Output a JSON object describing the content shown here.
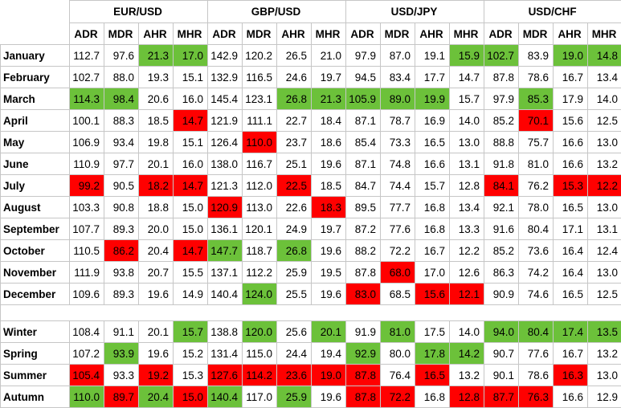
{
  "colors": {
    "high": "#6cc13a",
    "low": "#ff0000",
    "grid": "#c6c6c6"
  },
  "pairs": [
    "EUR/USD",
    "GBP/USD",
    "USD/JPY",
    "USD/CHF"
  ],
  "metrics": [
    "ADR",
    "MDR",
    "AHR",
    "MHR"
  ],
  "months": [
    {
      "label": "January",
      "values": [
        "112.7",
        "97.6",
        "21.3",
        "17.0",
        "142.9",
        "120.2",
        "26.5",
        "21.0",
        "97.9",
        "87.0",
        "19.1",
        "15.9",
        "102.7",
        "83.9",
        "19.0",
        "14.8"
      ],
      "hl": [
        "",
        "",
        "g",
        "g",
        "",
        "",
        "",
        "",
        "",
        "",
        "",
        "g",
        "g",
        "",
        "g",
        "g"
      ]
    },
    {
      "label": "February",
      "values": [
        "102.7",
        "88.0",
        "19.3",
        "15.1",
        "132.9",
        "116.5",
        "24.6",
        "19.7",
        "94.5",
        "83.4",
        "17.7",
        "14.7",
        "87.8",
        "78.6",
        "16.7",
        "13.4"
      ],
      "hl": [
        "",
        "",
        "",
        "",
        "",
        "",
        "",
        "",
        "",
        "",
        "",
        "",
        "",
        "",
        "",
        ""
      ]
    },
    {
      "label": "March",
      "values": [
        "114.3",
        "98.4",
        "20.6",
        "16.0",
        "145.4",
        "123.1",
        "26.8",
        "21.3",
        "105.9",
        "89.0",
        "19.9",
        "15.7",
        "97.9",
        "85.3",
        "17.9",
        "14.0"
      ],
      "hl": [
        "g",
        "g",
        "",
        "",
        "",
        "",
        "g",
        "g",
        "g",
        "g",
        "g",
        "",
        "",
        "g",
        "",
        ""
      ]
    },
    {
      "label": "April",
      "values": [
        "100.1",
        "88.3",
        "18.5",
        "14.7",
        "121.9",
        "111.1",
        "22.7",
        "18.4",
        "87.1",
        "78.7",
        "16.9",
        "14.0",
        "85.2",
        "70.1",
        "15.6",
        "12.5"
      ],
      "hl": [
        "",
        "",
        "",
        "r",
        "",
        "",
        "",
        "",
        "",
        "",
        "",
        "",
        "",
        "r",
        "",
        ""
      ]
    },
    {
      "label": "May",
      "values": [
        "106.9",
        "93.4",
        "19.8",
        "15.1",
        "126.4",
        "110.0",
        "23.7",
        "18.6",
        "85.4",
        "73.3",
        "16.5",
        "13.0",
        "88.8",
        "75.7",
        "16.6",
        "13.0"
      ],
      "hl": [
        "",
        "",
        "",
        "",
        "",
        "r",
        "",
        "",
        "",
        "",
        "",
        "",
        "",
        "",
        "",
        ""
      ]
    },
    {
      "label": "June",
      "values": [
        "110.9",
        "97.7",
        "20.1",
        "16.0",
        "138.0",
        "116.7",
        "25.1",
        "19.6",
        "87.1",
        "74.8",
        "16.6",
        "13.1",
        "91.8",
        "81.0",
        "16.6",
        "13.2"
      ],
      "hl": [
        "",
        "",
        "",
        "",
        "",
        "",
        "",
        "",
        "",
        "",
        "",
        "",
        "",
        "",
        "",
        ""
      ]
    },
    {
      "label": "July",
      "values": [
        "99.2",
        "90.5",
        "18.2",
        "14.7",
        "121.3",
        "112.0",
        "22.5",
        "18.5",
        "84.7",
        "74.4",
        "15.7",
        "12.8",
        "84.1",
        "76.2",
        "15.3",
        "12.2"
      ],
      "hl": [
        "r",
        "",
        "r",
        "r",
        "",
        "",
        "r",
        "",
        "",
        "",
        "",
        "",
        "r",
        "",
        "r",
        "r"
      ]
    },
    {
      "label": "August",
      "values": [
        "103.3",
        "90.8",
        "18.8",
        "15.0",
        "120.9",
        "113.0",
        "22.6",
        "18.3",
        "89.5",
        "77.7",
        "16.8",
        "13.4",
        "92.1",
        "78.0",
        "16.5",
        "13.0"
      ],
      "hl": [
        "",
        "",
        "",
        "",
        "r",
        "",
        "",
        "r",
        "",
        "",
        "",
        "",
        "",
        "",
        "",
        ""
      ]
    },
    {
      "label": "September",
      "values": [
        "107.7",
        "89.3",
        "20.0",
        "15.0",
        "136.1",
        "120.1",
        "24.9",
        "19.7",
        "87.2",
        "77.6",
        "16.8",
        "13.3",
        "91.6",
        "80.4",
        "17.1",
        "13.1"
      ],
      "hl": [
        "",
        "",
        "",
        "",
        "",
        "",
        "",
        "",
        "",
        "",
        "",
        "",
        "",
        "",
        "",
        ""
      ]
    },
    {
      "label": "October",
      "values": [
        "110.5",
        "86.2",
        "20.4",
        "14.7",
        "147.7",
        "118.7",
        "26.8",
        "19.6",
        "88.2",
        "72.2",
        "16.7",
        "12.2",
        "85.2",
        "73.6",
        "16.4",
        "12.4"
      ],
      "hl": [
        "",
        "r",
        "",
        "r",
        "g",
        "",
        "g",
        "",
        "",
        "",
        "",
        "",
        "",
        "",
        "",
        ""
      ]
    },
    {
      "label": "November",
      "values": [
        "111.9",
        "93.8",
        "20.7",
        "15.5",
        "137.1",
        "112.2",
        "25.9",
        "19.5",
        "87.8",
        "68.0",
        "17.0",
        "12.6",
        "86.3",
        "74.2",
        "16.4",
        "13.0"
      ],
      "hl": [
        "",
        "",
        "",
        "",
        "",
        "",
        "",
        "",
        "",
        "r",
        "",
        "",
        "",
        "",
        "",
        ""
      ]
    },
    {
      "label": "December",
      "values": [
        "109.6",
        "89.3",
        "19.6",
        "14.9",
        "140.4",
        "124.0",
        "25.5",
        "19.6",
        "83.0",
        "68.5",
        "15.6",
        "12.1",
        "90.9",
        "74.6",
        "16.5",
        "12.5"
      ],
      "hl": [
        "",
        "",
        "",
        "",
        "",
        "g",
        "",
        "",
        "r",
        "",
        "r",
        "r",
        "",
        "",
        "",
        ""
      ]
    }
  ],
  "seasons": [
    {
      "label": "Winter",
      "values": [
        "108.4",
        "91.1",
        "20.1",
        "15.7",
        "138.8",
        "120.0",
        "25.6",
        "20.1",
        "91.9",
        "81.0",
        "17.5",
        "14.0",
        "94.0",
        "80.4",
        "17.4",
        "13.5"
      ],
      "hl": [
        "",
        "",
        "",
        "g",
        "",
        "g",
        "",
        "g",
        "",
        "g",
        "",
        "",
        "g",
        "g",
        "g",
        "g"
      ]
    },
    {
      "label": "Spring",
      "values": [
        "107.2",
        "93.9",
        "19.6",
        "15.2",
        "131.4",
        "115.0",
        "24.4",
        "19.4",
        "92.9",
        "80.0",
        "17.8",
        "14.2",
        "90.7",
        "77.6",
        "16.7",
        "13.2"
      ],
      "hl": [
        "",
        "g",
        "",
        "",
        "",
        "",
        "",
        "",
        "g",
        "",
        "g",
        "g",
        "",
        "",
        "",
        ""
      ]
    },
    {
      "label": "Summer",
      "values": [
        "105.4",
        "93.3",
        "19.2",
        "15.3",
        "127.6",
        "114.2",
        "23.6",
        "19.0",
        "87.8",
        "76.4",
        "16.5",
        "13.2",
        "90.1",
        "78.6",
        "16.3",
        "13.0"
      ],
      "hl": [
        "r",
        "",
        "r",
        "",
        "r",
        "r",
        "r",
        "r",
        "r",
        "",
        "r",
        "",
        "",
        "",
        "r",
        ""
      ]
    },
    {
      "label": "Autumn",
      "values": [
        "110.0",
        "89.7",
        "20.4",
        "15.0",
        "140.4",
        "117.0",
        "25.9",
        "19.6",
        "87.8",
        "72.2",
        "16.8",
        "12.8",
        "87.7",
        "76.3",
        "16.6",
        "12.9"
      ],
      "hl": [
        "g",
        "r",
        "g",
        "r",
        "g",
        "",
        "g",
        "",
        "r",
        "r",
        "",
        "r",
        "r",
        "r",
        "",
        ""
      ]
    }
  ]
}
